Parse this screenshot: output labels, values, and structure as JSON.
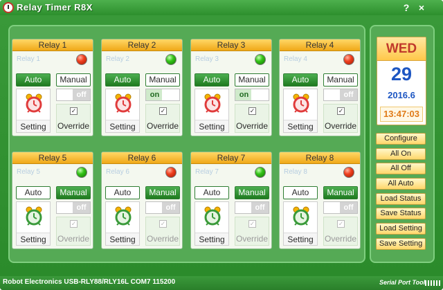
{
  "window": {
    "title": "Relay Timer R8X"
  },
  "colors": {
    "accent_green": "#2d8f2d",
    "header_gold": "#ffc84a",
    "led_red": "#f04020",
    "led_green": "#34c418"
  },
  "relays": [
    {
      "header": "Relay 1",
      "name": "Relay 1",
      "led": "red",
      "mode": "auto",
      "auto_label": "Auto",
      "manual_label": "Manual",
      "toggle_state": "off",
      "on_label": "on",
      "off_label": "off",
      "setting_label": "Setting",
      "override_label": "Override",
      "override_checked": true,
      "clock_color": "red"
    },
    {
      "header": "Relay 2",
      "name": "Relay 2",
      "led": "green",
      "mode": "auto",
      "auto_label": "Auto",
      "manual_label": "Manual",
      "toggle_state": "on",
      "on_label": "on",
      "off_label": "off",
      "setting_label": "Setting",
      "override_label": "Override",
      "override_checked": true,
      "clock_color": "red"
    },
    {
      "header": "Relay 3",
      "name": "Relay 3",
      "led": "green",
      "mode": "auto",
      "auto_label": "Auto",
      "manual_label": "Manual",
      "toggle_state": "on",
      "on_label": "on",
      "off_label": "off",
      "setting_label": "Setting",
      "override_label": "Override",
      "override_checked": true,
      "clock_color": "red"
    },
    {
      "header": "Relay 4",
      "name": "Relay 4",
      "led": "red",
      "mode": "auto",
      "auto_label": "Auto",
      "manual_label": "Manual",
      "toggle_state": "off",
      "on_label": "on",
      "off_label": "off",
      "setting_label": "Setting",
      "override_label": "Override",
      "override_checked": true,
      "clock_color": "red"
    },
    {
      "header": "Relay 5",
      "name": "Relay 5",
      "led": "green",
      "mode": "manual",
      "auto_label": "Auto",
      "manual_label": "Manual",
      "toggle_state": "off",
      "on_label": "on",
      "off_label": "off",
      "setting_label": "Setting",
      "override_label": "Override",
      "override_checked": true,
      "clock_color": "green"
    },
    {
      "header": "Relay 6",
      "name": "Relay 6",
      "led": "red",
      "mode": "manual",
      "auto_label": "Auto",
      "manual_label": "Manual",
      "toggle_state": "off",
      "on_label": "on",
      "off_label": "off",
      "setting_label": "Setting",
      "override_label": "Override",
      "override_checked": true,
      "clock_color": "green"
    },
    {
      "header": "Relay 7",
      "name": "Relay 7",
      "led": "green",
      "mode": "manual",
      "auto_label": "Auto",
      "manual_label": "Manual",
      "toggle_state": "off",
      "on_label": "on",
      "off_label": "off",
      "setting_label": "Setting",
      "override_label": "Override",
      "override_checked": true,
      "clock_color": "green"
    },
    {
      "header": "Relay 8",
      "name": "Relay 8",
      "led": "red",
      "mode": "manual",
      "auto_label": "Auto",
      "manual_label": "Manual",
      "toggle_state": "off",
      "on_label": "on",
      "off_label": "off",
      "setting_label": "Setting",
      "override_label": "Override",
      "override_checked": true,
      "clock_color": "green"
    }
  ],
  "date": {
    "day": "WED",
    "date": "29",
    "year_month": "2016.6",
    "time": "13:47:03"
  },
  "side_buttons": [
    "Configure",
    "All On",
    "All Off",
    "All Auto",
    "Load Status",
    "Save Status",
    "Load Setting",
    "Save Setting"
  ],
  "status": {
    "text": "Robot Electronics USB-RLY88/RLY16L COM7 115200",
    "logo": "Serial Port Tool"
  },
  "titlebar_buttons": {
    "help": "?",
    "close": "×"
  }
}
